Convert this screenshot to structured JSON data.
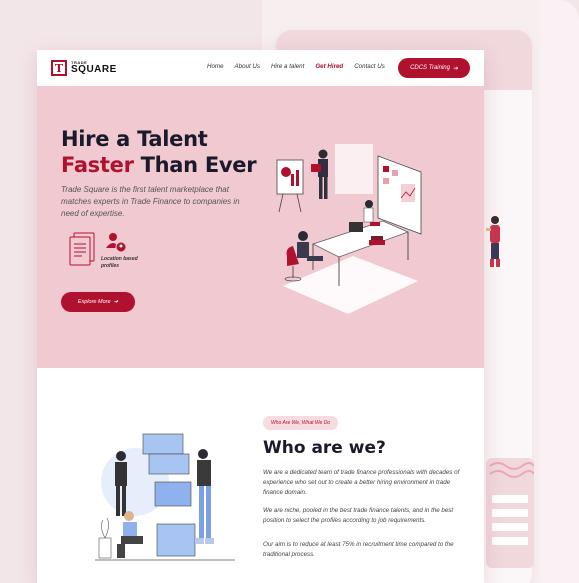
{
  "nav": {
    "logo_top": "TRADE",
    "logo_bottom": "SQUARE",
    "logo_mark": "T",
    "links": [
      "Home",
      "About Us",
      "Hire a talent",
      "Get Hired",
      "Contact Us"
    ],
    "active_link": "Get Hired",
    "cta": "CDCS Training"
  },
  "hero": {
    "title_line1": "Hire a Talent",
    "title_accent": "Faster",
    "title_rest": " Than Ever",
    "description": "Trade Square is the first talent marketplace that matches experts in Trade Finance to companies in need of expertise.",
    "feature_label": "Location based profiles",
    "button": "Explore More"
  },
  "about": {
    "tag": "Who Are We, What We Do",
    "title": "Who are we?",
    "p1": "We are a dedicated team of trade finance professionals with decades of experience who set out to create a better hiring environment in trade finance domain.",
    "p2": "We are niche, pooled in the best trade finance talents, and in the best position to select the profiles according to job requirements.",
    "p3": "Our aim is to reduce at least 75% in recruitment time compared to the traditional process."
  },
  "colors": {
    "brand": "#b0112e",
    "hero_bg": "#f1c9d0",
    "page_bg": "#f3e6e9"
  },
  "icons": [
    "arrow-right-icon",
    "document-icon",
    "location-person-icon"
  ]
}
